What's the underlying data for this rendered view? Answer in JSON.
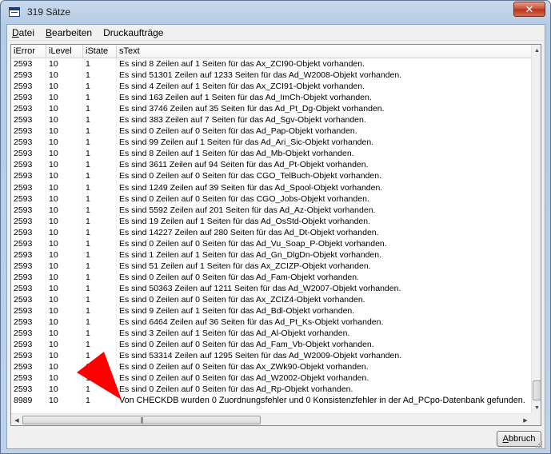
{
  "window": {
    "title": "319 Sätze",
    "close_glyph": "✕"
  },
  "menu": [
    {
      "pre": "",
      "accel": "D",
      "post": "atei"
    },
    {
      "pre": "",
      "accel": "B",
      "post": "earbeiten"
    },
    {
      "pre": "Druckaufträge",
      "accel": "",
      "post": ""
    }
  ],
  "table": {
    "headers": [
      "iError",
      "iLevel",
      "iState",
      "sText"
    ],
    "rows": [
      [
        "2593",
        "10",
        "1",
        "Es sind 8 Zeilen auf 1 Seiten für das Ax_ZCI90-Objekt vorhanden."
      ],
      [
        "2593",
        "10",
        "1",
        "Es sind 51301 Zeilen auf 1233 Seiten für das Ad_W2008-Objekt vorhanden."
      ],
      [
        "2593",
        "10",
        "1",
        "Es sind 4 Zeilen auf 1 Seiten für das Ax_ZCI91-Objekt vorhanden."
      ],
      [
        "2593",
        "10",
        "1",
        "Es sind 163 Zeilen auf 1 Seiten für das Ad_ImCh-Objekt vorhanden."
      ],
      [
        "2593",
        "10",
        "1",
        "Es sind 3746 Zeilen auf 35 Seiten für das Ad_Pt_Dg-Objekt vorhanden."
      ],
      [
        "2593",
        "10",
        "1",
        "Es sind 383 Zeilen auf 7 Seiten für das Ad_Sgv-Objekt vorhanden."
      ],
      [
        "2593",
        "10",
        "1",
        "Es sind 0 Zeilen auf 0 Seiten für das Ad_Pap-Objekt vorhanden."
      ],
      [
        "2593",
        "10",
        "1",
        "Es sind 99 Zeilen auf 1 Seiten für das Ad_Ari_Sic-Objekt vorhanden."
      ],
      [
        "2593",
        "10",
        "1",
        "Es sind 8 Zeilen auf 1 Seiten für das Ad_Mb-Objekt vorhanden."
      ],
      [
        "2593",
        "10",
        "1",
        "Es sind 3611 Zeilen auf 94 Seiten für das Ad_Pt-Objekt vorhanden."
      ],
      [
        "2593",
        "10",
        "1",
        "Es sind 0 Zeilen auf 0 Seiten für das CGO_TelBuch-Objekt vorhanden."
      ],
      [
        "2593",
        "10",
        "1",
        "Es sind 1249 Zeilen auf 39 Seiten für das Ad_Spool-Objekt vorhanden."
      ],
      [
        "2593",
        "10",
        "1",
        "Es sind 0 Zeilen auf 0 Seiten für das CGO_Jobs-Objekt vorhanden."
      ],
      [
        "2593",
        "10",
        "1",
        "Es sind 5592 Zeilen auf 201 Seiten für das Ad_Az-Objekt vorhanden."
      ],
      [
        "2593",
        "10",
        "1",
        "Es sind 19 Zeilen auf 1 Seiten für das Ad_OsStd-Objekt vorhanden."
      ],
      [
        "2593",
        "10",
        "1",
        "Es sind 14227 Zeilen auf 280 Seiten für das Ad_Dt-Objekt vorhanden."
      ],
      [
        "2593",
        "10",
        "1",
        "Es sind 0 Zeilen auf 0 Seiten für das Ad_Vu_Soap_P-Objekt vorhanden."
      ],
      [
        "2593",
        "10",
        "1",
        "Es sind 1 Zeilen auf 1 Seiten für das Ad_Gn_DlgDn-Objekt vorhanden."
      ],
      [
        "2593",
        "10",
        "1",
        "Es sind 51 Zeilen auf 1 Seiten für das Ax_ZCIZP-Objekt vorhanden."
      ],
      [
        "2593",
        "10",
        "1",
        "Es sind 0 Zeilen auf 0 Seiten für das Ad_Fam-Objekt vorhanden."
      ],
      [
        "2593",
        "10",
        "1",
        "Es sind 50363 Zeilen auf 1211 Seiten für das Ad_W2007-Objekt vorhanden."
      ],
      [
        "2593",
        "10",
        "1",
        "Es sind 0 Zeilen auf 0 Seiten für das Ax_ZCIZ4-Objekt vorhanden."
      ],
      [
        "2593",
        "10",
        "1",
        "Es sind 9 Zeilen auf 1 Seiten für das Ad_Bdl-Objekt vorhanden."
      ],
      [
        "2593",
        "10",
        "1",
        "Es sind 6464 Zeilen auf 36 Seiten für das Ad_Pt_Ks-Objekt vorhanden."
      ],
      [
        "2593",
        "10",
        "1",
        "Es sind 3 Zeilen auf 1 Seiten für das Ad_Al-Objekt vorhanden."
      ],
      [
        "2593",
        "10",
        "1",
        "Es sind 0 Zeilen auf 0 Seiten für das Ad_Fam_Vb-Objekt vorhanden."
      ],
      [
        "2593",
        "10",
        "1",
        "Es sind 53314 Zeilen auf 1295 Seiten für das Ad_W2009-Objekt vorhanden."
      ],
      [
        "2593",
        "10",
        "1",
        "Es sind 0 Zeilen auf 0 Seiten für das Ax_ZWk90-Objekt vorhanden."
      ],
      [
        "2593",
        "10",
        "1",
        "Es sind 0 Zeilen auf 0 Seiten für das Ad_W2002-Objekt vorhanden."
      ],
      [
        "2593",
        "10",
        "1",
        "Es sind 0 Zeilen auf 0 Seiten für das Ad_Rp-Objekt vorhanden."
      ],
      [
        "8989",
        "10",
        "1",
        "Von CHECKDB wurden 0 Zuordnungsfehler und 0 Konsistenzfehler in der Ad_PCpo-Datenbank gefunden."
      ]
    ]
  },
  "scroll": {
    "h_thumb_glyph": "|||",
    "left_glyph": "◀",
    "right_glyph": "▶",
    "up_glyph": "▲",
    "down_glyph": "▼"
  },
  "buttons": {
    "abort_pre": "",
    "abort_accel": "A",
    "abort_post": "bbruch"
  },
  "colors": {
    "arrow": "#ff0000",
    "title_gradient_top": "#c9d9ec",
    "close_red": "#c74a31"
  }
}
